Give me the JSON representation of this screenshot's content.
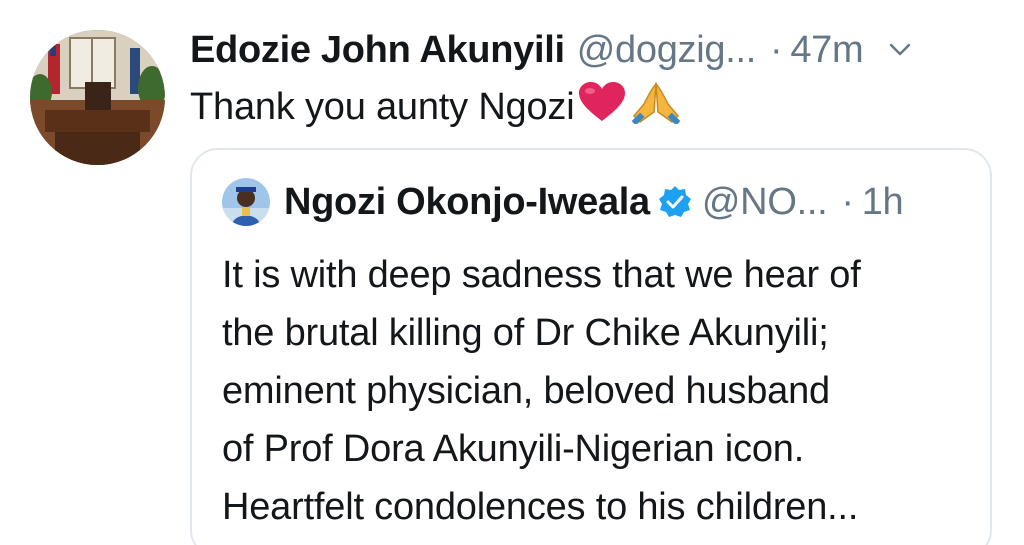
{
  "tweet": {
    "author_name": "Edozie John Akunyili",
    "handle": "@dogzig...",
    "separator": "·",
    "time": "47m",
    "text": "Thank you aunty Ngozi",
    "emojis": [
      "red-heart",
      "folded-hands"
    ],
    "menu_icon": "chevron-down-icon"
  },
  "quoted": {
    "author_name": "Ngozi Okonjo-Iweala",
    "verified_icon": "verified-badge-icon",
    "handle": "@NO...",
    "separator": "·",
    "time": "1h",
    "lines": [
      "It is with deep sadness that we hear of",
      "the brutal killing of Dr Chike Akunyili;",
      "eminent physician, beloved husband",
      "of Prof Dora Akunyili-Nigerian icon.",
      "Heartfelt condolences to his children..."
    ]
  },
  "colors": {
    "text": "#14171a",
    "secondary": "#657786",
    "border": "#e1e8ed",
    "verified": "#1da1f2",
    "heart": "#e0245e"
  }
}
